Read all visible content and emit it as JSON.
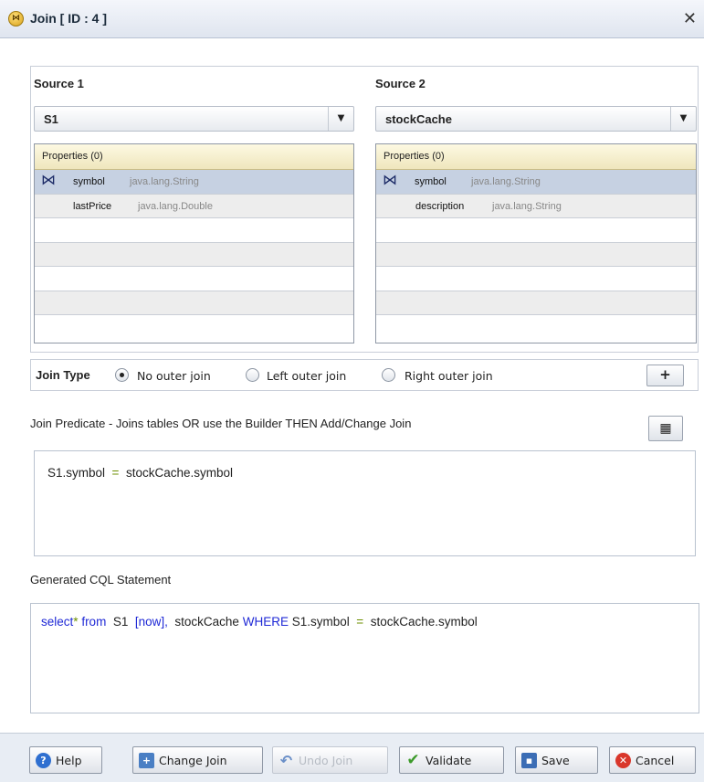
{
  "window": {
    "title": "Join [ ID : 4 ]",
    "close_glyph": "✕"
  },
  "source1": {
    "label": "Source 1",
    "selected": "S1",
    "properties_header": "Properties (0)",
    "rows": [
      {
        "name": "symbol",
        "type": "java.lang.String",
        "joined": true
      },
      {
        "name": "lastPrice",
        "type": "java.lang.Double",
        "joined": false
      }
    ]
  },
  "source2": {
    "label": "Source 2",
    "selected": "stockCache",
    "properties_header": "Properties (0)",
    "rows": [
      {
        "name": "symbol",
        "type": "java.lang.String",
        "joined": true
      },
      {
        "name": "description",
        "type": "java.lang.String",
        "joined": false
      }
    ]
  },
  "join_type": {
    "label": "Join Type",
    "options": [
      "No outer join",
      "Left outer join",
      "Right outer join"
    ],
    "selected": "No outer join",
    "add_label": "+"
  },
  "predicate": {
    "label": "Join Predicate - Joins tables OR use the Builder THEN Add/Change Join",
    "left": "S1.symbol",
    "op": "=",
    "right": "stockCache.symbol"
  },
  "generated": {
    "label": "Generated CQL Statement",
    "kw_select": "select",
    "star": "*",
    "kw_from": "from",
    "source1": "S1",
    "window": "[now],",
    "source2": "stockCache",
    "kw_where": "WHERE",
    "left": "S1.symbol",
    "op": "=",
    "right": "stockCache.symbol"
  },
  "footer": {
    "help": "Help",
    "change_join": "Change Join",
    "undo_join": "Undo Join",
    "validate": "Validate",
    "save": "Save",
    "cancel": "Cancel"
  },
  "colors": {
    "keyword": "#1f29d6",
    "operator": "#6d8f00",
    "selected_row": "#c6d1e2",
    "header_bg": "#efe6bd"
  }
}
